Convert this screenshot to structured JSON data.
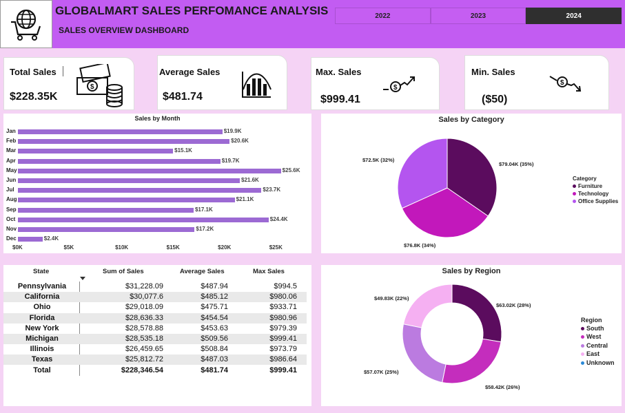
{
  "header": {
    "title": "GLOBALMART SALES PERFOMANCE ANALYSIS",
    "subtitle": "SALES OVERVIEW DASHBOARD",
    "logo_icon": "globe-cart-icon",
    "years": [
      "2022",
      "2023",
      "2024"
    ],
    "selected_year": "2024"
  },
  "kpis": {
    "total": {
      "label": "Total Sales",
      "value": "$228.35K",
      "icon": "money-stack-icon"
    },
    "average": {
      "label": "Average Sales",
      "value": "$481.74",
      "icon": "bell-curve-chart-icon"
    },
    "max": {
      "label": "Max. Sales",
      "value": "$999.41",
      "icon": "dollar-up-trend-icon"
    },
    "min": {
      "label": "Min. Sales",
      "value": "($50)",
      "icon": "dollar-down-trend-icon"
    }
  },
  "chart_data": [
    {
      "type": "bar",
      "orientation": "horizontal",
      "title": "Sales by Month",
      "categories": [
        "Jan",
        "Feb",
        "Mar",
        "Apr",
        "May",
        "Jun",
        "Jul",
        "Aug",
        "Sep",
        "Oct",
        "Nov",
        "Dec"
      ],
      "values": [
        19.9,
        20.6,
        15.1,
        19.7,
        25.6,
        21.6,
        23.7,
        21.1,
        17.1,
        24.4,
        17.2,
        2.4
      ],
      "data_labels": [
        "$19.9K",
        "$20.6K",
        "$15.1K",
        "$19.7K",
        "$25.6K",
        "$21.6K",
        "$23.7K",
        "$21.1K",
        "$17.1K",
        "$24.4K",
        "$17.2K",
        "$2.4K"
      ],
      "x_ticks": [
        "$0K",
        "$5K",
        "$10K",
        "$15K",
        "$20K",
        "$25K"
      ],
      "xlim": [
        0,
        27.5
      ],
      "color": "#9c6ad3"
    },
    {
      "type": "pie",
      "title": "Sales by Category",
      "legend_title": "Category",
      "legend_position": "right",
      "slices": [
        {
          "name": "Furniture",
          "value": 79.04,
          "label": "$79.04K (35%)",
          "color": "#5b0c5e"
        },
        {
          "name": "Technology",
          "value": 76.8,
          "label": "$76.8K (34%)",
          "color": "#c218bb"
        },
        {
          "name": "Office Supplies",
          "value": 72.5,
          "label": "$72.5K (32%)",
          "color": "#b455ef"
        }
      ]
    },
    {
      "type": "pie",
      "variant": "donut",
      "title": "Sales by Region",
      "legend_title": "Region",
      "legend_position": "right",
      "slices": [
        {
          "name": "South",
          "value": 63.02,
          "label": "$63.02K (28%)",
          "color": "#5b0c5e"
        },
        {
          "name": "West",
          "value": 58.42,
          "label": "$58.42K (26%)",
          "color": "#c42dbd"
        },
        {
          "name": "Central",
          "value": 57.07,
          "label": "$57.07K (25%)",
          "color": "#bb7be0"
        },
        {
          "name": "East",
          "value": 49.83,
          "label": "$49.83K (22%)",
          "color": "#f5b0f2"
        },
        {
          "name": "Unknown",
          "value": 0,
          "label": "",
          "color": "#2b8ad8"
        }
      ]
    }
  ],
  "state_table": {
    "columns": [
      "State",
      "Sum of Sales",
      "Average Sales",
      "Max Sales"
    ],
    "rows": [
      [
        "Pennsylvania",
        "$31,228.09",
        "$487.94",
        "$994.5"
      ],
      [
        "California",
        "$30,077.6",
        "$485.12",
        "$980.06"
      ],
      [
        "Ohio",
        "$29,018.09",
        "$475.71",
        "$933.71"
      ],
      [
        "Florida",
        "$28,636.33",
        "$454.54",
        "$980.96"
      ],
      [
        "New York",
        "$28,578.88",
        "$453.63",
        "$979.39"
      ],
      [
        "Michigan",
        "$28,535.18",
        "$509.56",
        "$999.41"
      ],
      [
        "Illinois",
        "$26,459.65",
        "$508.84",
        "$973.79"
      ],
      [
        "Texas",
        "$25,812.72",
        "$487.03",
        "$986.64"
      ]
    ],
    "total": [
      "Total",
      "$228,346.54",
      "$481.74",
      "$999.41"
    ],
    "sort_icon": "sort-descending-icon"
  }
}
